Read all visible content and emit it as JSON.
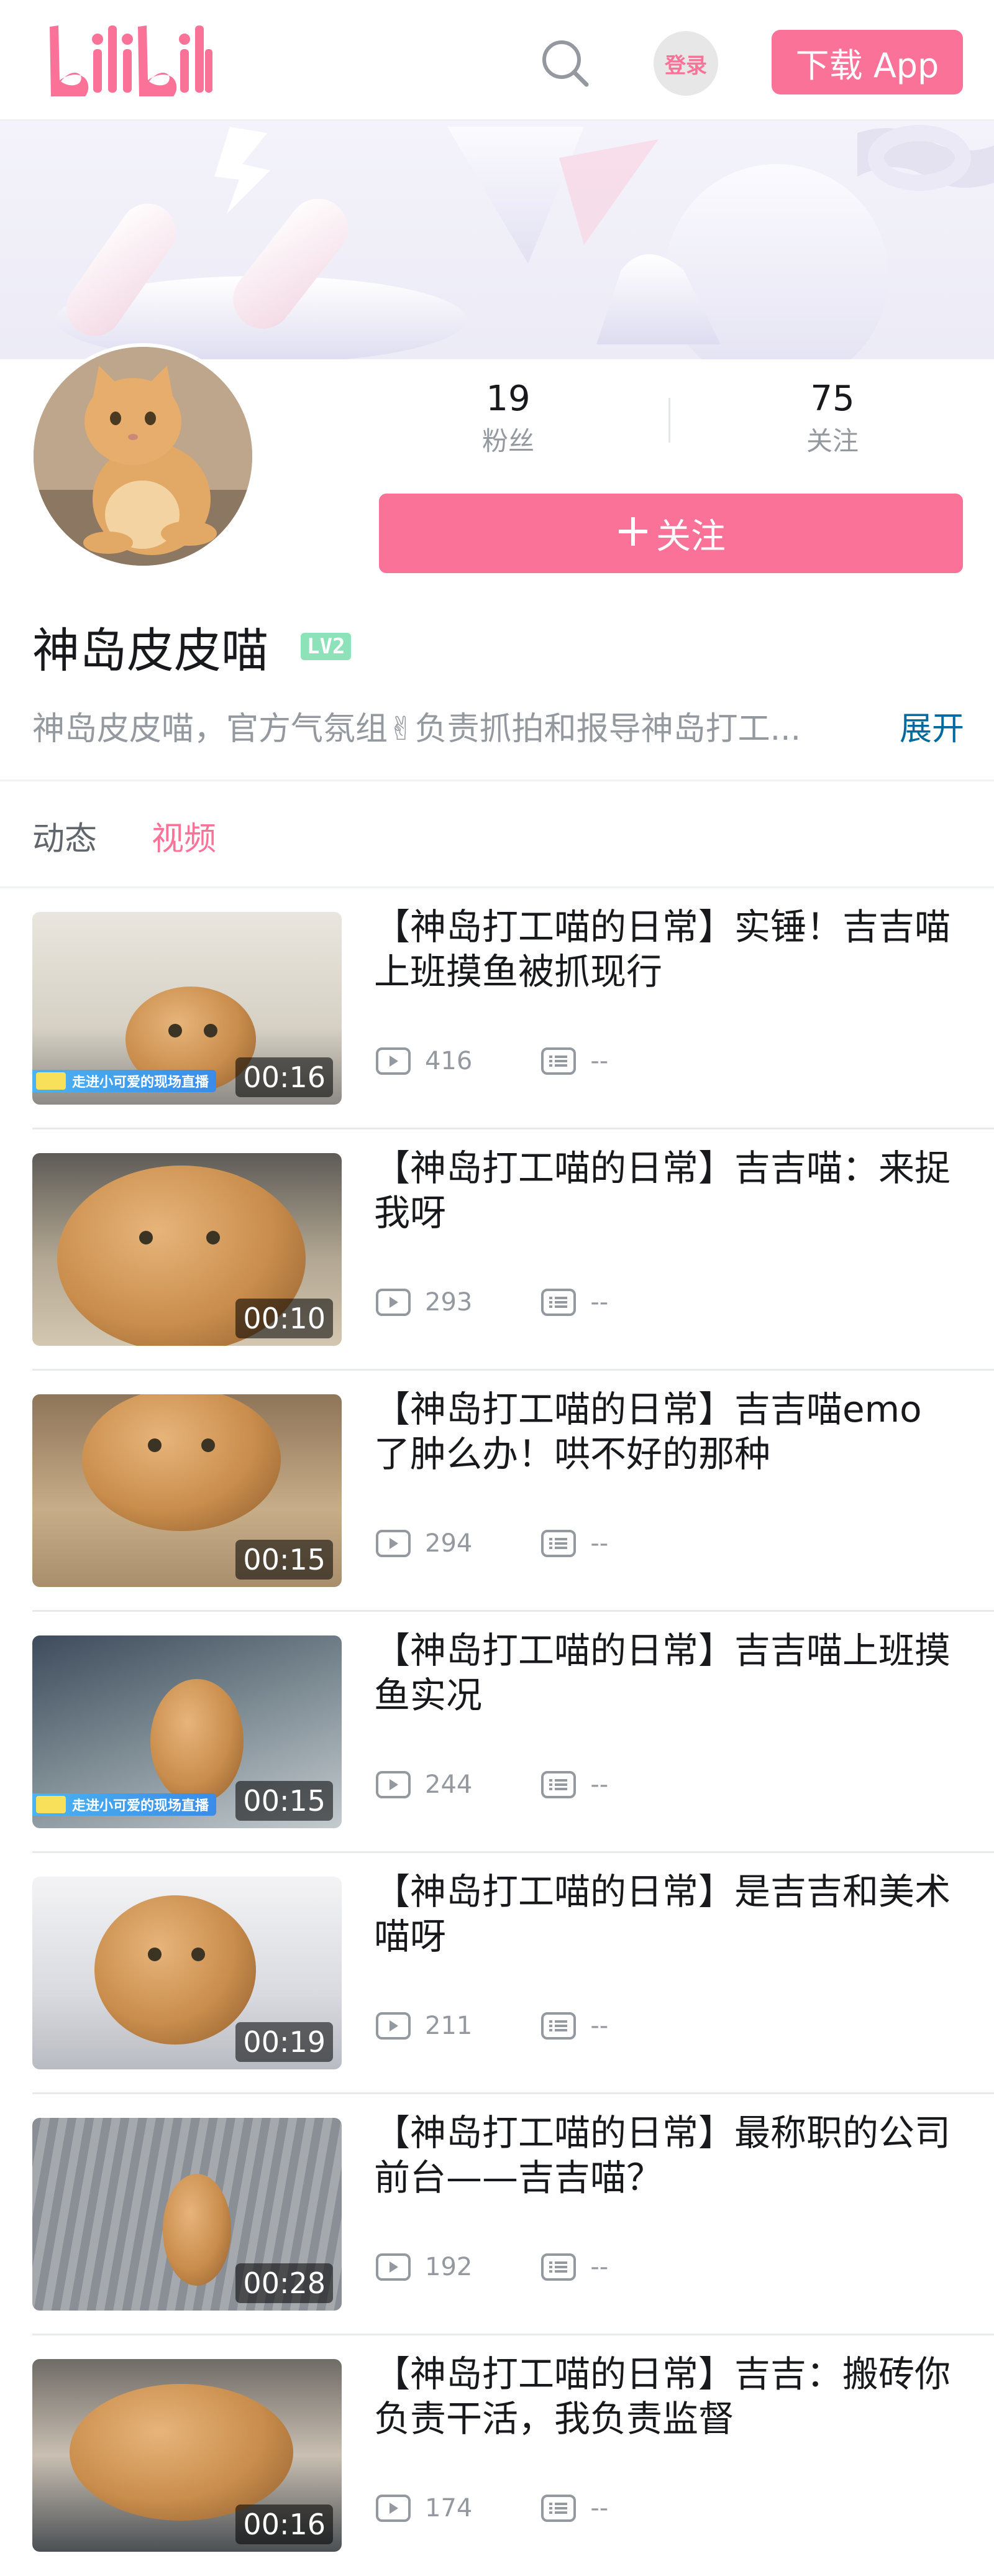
{
  "header": {
    "logo_text": "bilibili",
    "login_label": "登录",
    "download_label": "下载 App"
  },
  "colors": {
    "brand_pink": "#fb7299",
    "level_green": "#8ee2b9",
    "link_blue": "#00699d"
  },
  "profile": {
    "stats": [
      {
        "value": "19",
        "label": "粉丝"
      },
      {
        "value": "75",
        "label": "关注"
      }
    ],
    "follow_label": "关注",
    "follow_icon": "plus-icon",
    "name": "神岛皮皮喵",
    "level": "LV2",
    "bio": "神岛皮皮喵，官方气氛组✌负责抓拍和报导神岛打工...",
    "expand_label": "展开"
  },
  "tabs": [
    {
      "label": "动态",
      "active": false
    },
    {
      "label": "视频",
      "active": true
    }
  ],
  "videos": [
    {
      "title": "【神岛打工喵的日常】实锤！吉吉喵上班摸鱼被抓现行",
      "duration": "00:16",
      "views": "416",
      "danmaku": "--",
      "live_label": "走进小可爱的现场直播"
    },
    {
      "title": "【神岛打工喵的日常】吉吉喵：来捉我呀",
      "duration": "00:10",
      "views": "293",
      "danmaku": "--"
    },
    {
      "title": "【神岛打工喵的日常】吉吉喵emo了肿么办！哄不好的那种",
      "duration": "00:15",
      "views": "294",
      "danmaku": "--"
    },
    {
      "title": "【神岛打工喵的日常】吉吉喵上班摸鱼实况",
      "duration": "00:15",
      "views": "244",
      "danmaku": "--",
      "live_label": "走进小可爱的现场直播"
    },
    {
      "title": "【神岛打工喵的日常】是吉吉和美术喵呀",
      "duration": "00:19",
      "views": "211",
      "danmaku": "--"
    },
    {
      "title": "【神岛打工喵的日常】最称职的公司前台——吉吉喵？",
      "duration": "00:28",
      "views": "192",
      "danmaku": "--"
    },
    {
      "title": "【神岛打工喵的日常】吉吉：搬砖你负责干活，我负责监督",
      "duration": "00:16",
      "views": "174",
      "danmaku": "--"
    }
  ]
}
